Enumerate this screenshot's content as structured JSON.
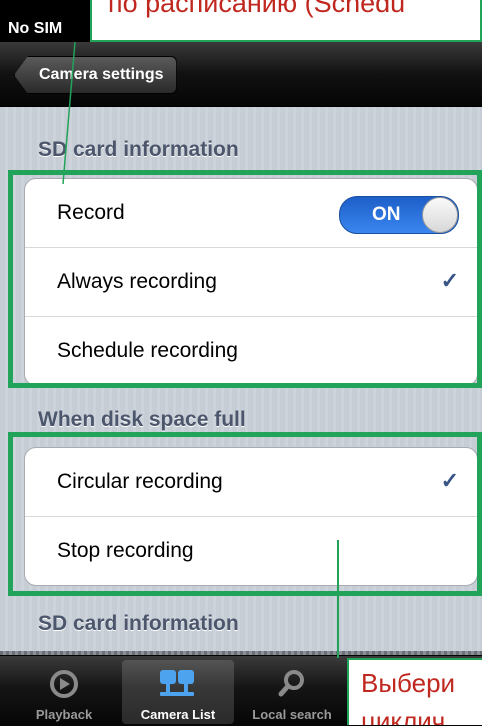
{
  "status_bar": {
    "carrier": "No SIM"
  },
  "nav_bar": {
    "back_button": "Camera settings"
  },
  "sections": [
    {
      "header": "SD card information"
    },
    {
      "header": "When disk space full"
    },
    {
      "header": "SD card information"
    }
  ],
  "recording_group": {
    "record_label": "Record",
    "record_toggle": "ON",
    "always_label": "Always recording",
    "always_checked": true,
    "schedule_label": "Schedule recording"
  },
  "disk_full_group": {
    "circular_label": "Circular recording",
    "circular_checked": true,
    "stop_label": "Stop recording"
  },
  "annotations": {
    "top_text": "по расписанию (Schedu",
    "bottom_line1": "Выбери",
    "bottom_line2": "циклич"
  },
  "tab_bar": {
    "tabs": [
      {
        "label": "Playback",
        "icon": "playback-icon",
        "selected": false
      },
      {
        "label": "Camera List",
        "icon": "camera-list-icon",
        "selected": true
      },
      {
        "label": "Local search",
        "icon": "search-icon",
        "selected": false
      }
    ]
  },
  "colors": {
    "annotation_green": "#21a35a",
    "annotation_red": "#c0281f",
    "toggle_blue": "#2a72e0",
    "check_blue": "#385487"
  }
}
